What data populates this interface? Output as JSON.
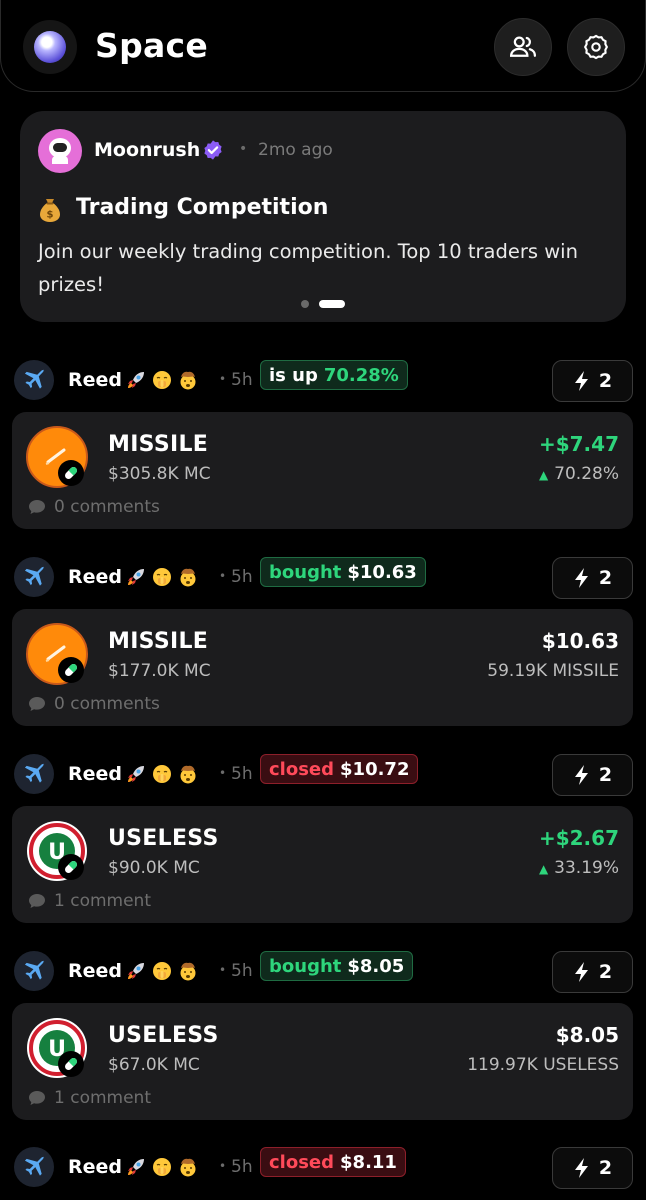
{
  "header": {
    "title": "Space"
  },
  "announcement": {
    "author": "Moonrush",
    "time": "2mo ago",
    "title": "Trading Competition",
    "body": "Join our weekly trading competition. Top 10 traders win prizes!"
  },
  "feed": [
    {
      "user": "Reed",
      "time": "5h",
      "action": "is up",
      "amount": "70.28%",
      "style": "up",
      "zaps": "2",
      "token": "MISSILE",
      "mc": "$305.8K MC",
      "value": "+$7.47",
      "sub": "70.28%",
      "comments": "0 comments"
    },
    {
      "user": "Reed",
      "time": "5h",
      "action": "bought",
      "amount": "$10.63",
      "style": "green",
      "zaps": "2",
      "token": "MISSILE",
      "mc": "$177.0K MC",
      "value": "$10.63",
      "sub": "59.19K MISSILE",
      "comments": "0 comments"
    },
    {
      "user": "Reed",
      "time": "5h",
      "action": "closed",
      "amount": "$10.72",
      "style": "red",
      "zaps": "2",
      "token": "USELESS",
      "mc": "$90.0K MC",
      "value": "+$2.67",
      "sub": "33.19%",
      "comments": "1 comment"
    },
    {
      "user": "Reed",
      "time": "5h",
      "action": "bought",
      "amount": "$8.05",
      "style": "green",
      "zaps": "2",
      "token": "USELESS",
      "mc": "$67.0K MC",
      "value": "$8.05",
      "sub": "119.97K USELESS",
      "comments": "1 comment"
    },
    {
      "user": "Reed",
      "time": "5h",
      "action": "closed",
      "amount": "$8.11",
      "style": "red",
      "zaps": "2"
    }
  ],
  "colors": {
    "positive": "#2ed57c",
    "negative": "#ff4a5a",
    "verified": "#8b5cf6"
  },
  "icons": [
    "planet-logo-icon",
    "users-icon",
    "gear-icon",
    "verified-badge-icon",
    "money-bag-icon",
    "airplane-icon",
    "rocket-emoji-icon",
    "shushing-face-emoji-icon",
    "exploding-head-emoji-icon",
    "lightning-icon",
    "comment-bubble-icon",
    "pill-badge-icon"
  ]
}
